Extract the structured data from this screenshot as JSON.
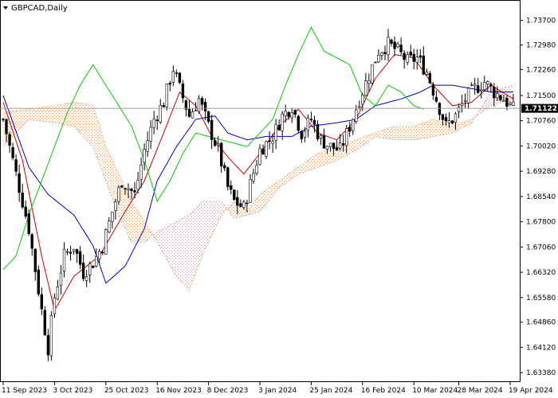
{
  "chart_data": {
    "type": "candlestick",
    "title": "GBPCAD,Daily",
    "current_price": "1.71122",
    "current_price_value": 1.71122,
    "ylim": [
      1.6329,
      1.7411
    ],
    "y_ticks": [
      "1.73700",
      "1.72980",
      "1.72260",
      "1.71500",
      "1.70760",
      "1.70020",
      "1.69280",
      "1.68540",
      "1.67800",
      "1.67060",
      "1.66320",
      "1.65580",
      "1.64860",
      "1.64120",
      "1.63380"
    ],
    "y_tick_values": [
      1.737,
      1.7298,
      1.7226,
      1.715,
      1.7076,
      1.7002,
      1.6928,
      1.6854,
      1.678,
      1.6706,
      1.6632,
      1.6558,
      1.6486,
      1.6412,
      1.6338
    ],
    "x_ticks": [
      "11 Sep 2023",
      "3 Oct 2023",
      "25 Oct 2023",
      "16 Nov 2023",
      "8 Dec 2023",
      "3 Jan 2024",
      "25 Jan 2024",
      "16 Feb 2024",
      "10 Mar 2024",
      "28 Mar 2024",
      "19 Apr 2024"
    ],
    "x_tick_index": [
      0,
      16,
      32,
      48,
      64,
      80,
      96,
      112,
      128,
      142,
      158
    ],
    "bar_count": 160,
    "close_anchors": [
      [
        0,
        1.708
      ],
      [
        4,
        1.692
      ],
      [
        8,
        1.676
      ],
      [
        12,
        1.652
      ],
      [
        14,
        1.641
      ],
      [
        16,
        1.656
      ],
      [
        19,
        1.668
      ],
      [
        22,
        1.671
      ],
      [
        25,
        1.663
      ],
      [
        28,
        1.666
      ],
      [
        31,
        1.671
      ],
      [
        34,
        1.681
      ],
      [
        37,
        1.69
      ],
      [
        41,
        1.686
      ],
      [
        44,
        1.699
      ],
      [
        47,
        1.708
      ],
      [
        50,
        1.713
      ],
      [
        53,
        1.723
      ],
      [
        55,
        1.717
      ],
      [
        58,
        1.709
      ],
      [
        61,
        1.714
      ],
      [
        64,
        1.706
      ],
      [
        67,
        1.699
      ],
      [
        70,
        1.688
      ],
      [
        72,
        1.684
      ],
      [
        75,
        1.682
      ],
      [
        77,
        1.689
      ],
      [
        80,
        1.699
      ],
      [
        84,
        1.703
      ],
      [
        87,
        1.709
      ],
      [
        90,
        1.712
      ],
      [
        93,
        1.704
      ],
      [
        96,
        1.708
      ],
      [
        99,
        1.702
      ],
      [
        102,
        1.7
      ],
      [
        105,
        1.699
      ],
      [
        108,
        1.706
      ],
      [
        111,
        1.714
      ],
      [
        114,
        1.721
      ],
      [
        117,
        1.728
      ],
      [
        120,
        1.73
      ],
      [
        123,
        1.728
      ],
      [
        126,
        1.725
      ],
      [
        129,
        1.726
      ],
      [
        132,
        1.722
      ],
      [
        135,
        1.714
      ],
      [
        138,
        1.706
      ],
      [
        141,
        1.709
      ],
      [
        144,
        1.714
      ],
      [
        147,
        1.717
      ],
      [
        150,
        1.719
      ],
      [
        153,
        1.716
      ],
      [
        156,
        1.714
      ],
      [
        159,
        1.711
      ]
    ],
    "series": [
      {
        "name": "",
        "color": "#cc0000",
        "anchors": [
          [
            0,
            1.713
          ],
          [
            6,
            1.696
          ],
          [
            12,
            1.668
          ],
          [
            16,
            1.652
          ],
          [
            22,
            1.662
          ],
          [
            30,
            1.668
          ],
          [
            38,
            1.681
          ],
          [
            44,
            1.69
          ],
          [
            50,
            1.704
          ],
          [
            55,
            1.716
          ],
          [
            60,
            1.712
          ],
          [
            65,
            1.703
          ],
          [
            70,
            1.697
          ],
          [
            75,
            1.692
          ],
          [
            80,
            1.698
          ],
          [
            86,
            1.706
          ],
          [
            92,
            1.711
          ],
          [
            98,
            1.704
          ],
          [
            104,
            1.702
          ],
          [
            110,
            1.708
          ],
          [
            116,
            1.72
          ],
          [
            122,
            1.727
          ],
          [
            128,
            1.726
          ],
          [
            134,
            1.718
          ],
          [
            140,
            1.712
          ],
          [
            146,
            1.713
          ],
          [
            152,
            1.718
          ],
          [
            159,
            1.714
          ]
        ]
      },
      {
        "name": "",
        "color": "#0000cc",
        "anchors": [
          [
            0,
            1.715
          ],
          [
            8,
            1.694
          ],
          [
            14,
            1.686
          ],
          [
            22,
            1.68
          ],
          [
            28,
            1.671
          ],
          [
            32,
            1.66
          ],
          [
            38,
            1.665
          ],
          [
            44,
            1.676
          ],
          [
            48,
            1.69
          ],
          [
            54,
            1.7
          ],
          [
            60,
            1.708
          ],
          [
            66,
            1.709
          ],
          [
            70,
            1.704
          ],
          [
            76,
            1.702
          ],
          [
            82,
            1.703
          ],
          [
            90,
            1.703
          ],
          [
            96,
            1.706
          ],
          [
            104,
            1.707
          ],
          [
            110,
            1.708
          ],
          [
            116,
            1.712
          ],
          [
            124,
            1.714
          ],
          [
            130,
            1.716
          ],
          [
            134,
            1.718
          ],
          [
            140,
            1.718
          ],
          [
            146,
            1.717
          ],
          [
            152,
            1.716
          ],
          [
            159,
            1.716
          ]
        ]
      },
      {
        "name": "",
        "color": "#00cc00",
        "anchors": [
          [
            0,
            1.664
          ],
          [
            4,
            1.668
          ],
          [
            8,
            1.68
          ],
          [
            12,
            1.69
          ],
          [
            16,
            1.7
          ],
          [
            20,
            1.71
          ],
          [
            24,
            1.718
          ],
          [
            28,
            1.724
          ],
          [
            32,
            1.718
          ],
          [
            36,
            1.712
          ],
          [
            40,
            1.706
          ],
          [
            44,
            1.696
          ],
          [
            48,
            1.684
          ],
          [
            52,
            1.69
          ],
          [
            56,
            1.698
          ],
          [
            60,
            1.704
          ],
          [
            64,
            1.703
          ],
          [
            68,
            1.702
          ],
          [
            72,
            1.701
          ],
          [
            76,
            1.7
          ],
          [
            80,
            1.704
          ],
          [
            84,
            1.708
          ],
          [
            88,
            1.718
          ],
          [
            92,
            1.727
          ],
          [
            96,
            1.735
          ],
          [
            100,
            1.728
          ],
          [
            104,
            1.726
          ],
          [
            108,
            1.724
          ],
          [
            112,
            1.715
          ],
          [
            116,
            1.712
          ],
          [
            120,
            1.718
          ],
          [
            124,
            1.716
          ],
          [
            128,
            1.712
          ],
          [
            131,
            1.711
          ]
        ]
      }
    ],
    "cloud": {
      "span_a": [
        [
          0,
          1.71
        ],
        [
          8,
          1.711
        ],
        [
          16,
          1.712
        ],
        [
          22,
          1.713
        ],
        [
          28,
          1.712
        ],
        [
          32,
          1.7
        ],
        [
          36,
          1.692
        ],
        [
          40,
          1.684
        ],
        [
          44,
          1.678
        ],
        [
          48,
          1.672
        ],
        [
          54,
          1.662
        ],
        [
          58,
          1.658
        ],
        [
          62,
          1.668
        ],
        [
          68,
          1.68
        ],
        [
          72,
          1.684
        ],
        [
          76,
          1.681
        ],
        [
          80,
          1.686
        ],
        [
          86,
          1.69
        ],
        [
          92,
          1.694
        ],
        [
          98,
          1.698
        ],
        [
          104,
          1.7
        ],
        [
          110,
          1.702
        ],
        [
          116,
          1.704
        ],
        [
          122,
          1.706
        ],
        [
          128,
          1.706
        ],
        [
          134,
          1.708
        ],
        [
          140,
          1.706
        ],
        [
          146,
          1.708
        ],
        [
          152,
          1.712
        ],
        [
          159,
          1.714
        ]
      ],
      "span_b": [
        [
          0,
          1.7
        ],
        [
          8,
          1.708
        ],
        [
          16,
          1.707
        ],
        [
          22,
          1.706
        ],
        [
          28,
          1.7
        ],
        [
          32,
          1.69
        ],
        [
          36,
          1.68
        ],
        [
          40,
          1.672
        ],
        [
          44,
          1.672
        ],
        [
          48,
          1.675
        ],
        [
          54,
          1.678
        ],
        [
          58,
          1.68
        ],
        [
          62,
          1.684
        ],
        [
          68,
          1.684
        ],
        [
          72,
          1.679
        ],
        [
          76,
          1.68
        ],
        [
          80,
          1.681
        ],
        [
          86,
          1.688
        ],
        [
          92,
          1.692
        ],
        [
          98,
          1.694
        ],
        [
          104,
          1.696
        ],
        [
          110,
          1.699
        ],
        [
          116,
          1.703
        ],
        [
          122,
          1.702
        ],
        [
          128,
          1.702
        ],
        [
          134,
          1.703
        ],
        [
          140,
          1.704
        ],
        [
          146,
          1.707
        ],
        [
          152,
          1.716
        ],
        [
          159,
          1.718
        ]
      ]
    },
    "colors": {
      "bull": "#ffffff",
      "bear": "#000000",
      "cloud_up": "#f4a26a",
      "cloud_down": "#c8a0a8",
      "grid": "#c0c0c0"
    }
  }
}
